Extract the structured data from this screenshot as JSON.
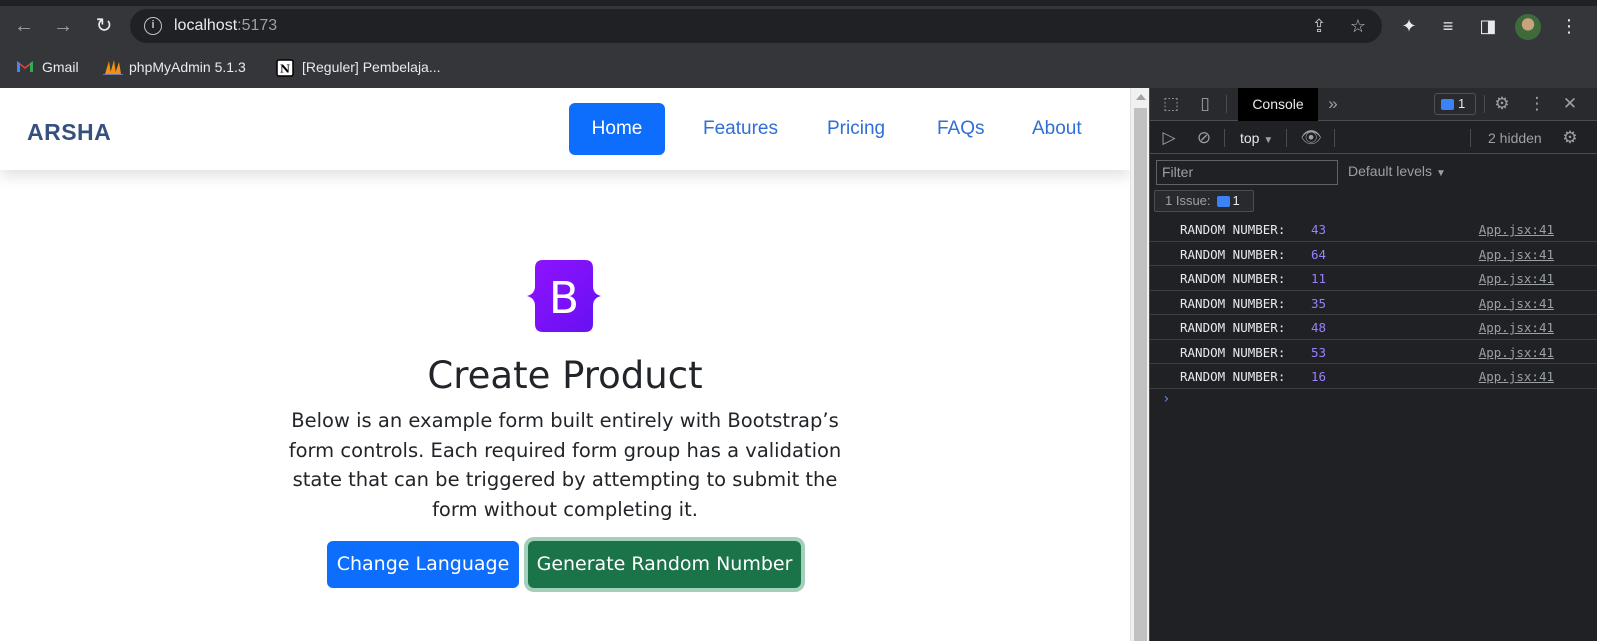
{
  "browser": {
    "url_host": "localhost",
    "url_port": ":5173",
    "bookmarks": [
      {
        "label": "Gmail"
      },
      {
        "label": "phpMyAdmin 5.1.3"
      },
      {
        "label": "[Reguler] Pembelaja..."
      }
    ]
  },
  "site": {
    "brand": "ARSHA",
    "nav": {
      "home": "Home",
      "features": "Features",
      "pricing": "Pricing",
      "faqs": "FAQs",
      "about": "About"
    },
    "logo_letter": "B",
    "title": "Create Product",
    "lead": "Below is an example form built entirely with Bootstrap’s form controls. Each required form group has a validation state that can be triggered by attempting to submit the form without completing it.",
    "buttons": {
      "change_language": "Change Language",
      "generate_random": "Generate Random Number"
    }
  },
  "devtools": {
    "tab_console": "Console",
    "issues_badge_count": "1",
    "context": "top",
    "hidden": "2 hidden",
    "filter_placeholder": "Filter",
    "levels": "Default levels",
    "issues_label": "1 Issue:",
    "issues_count": "1",
    "logs": [
      {
        "label": "RANDOM NUMBER:",
        "value": "43",
        "source": "App.jsx:41"
      },
      {
        "label": "RANDOM NUMBER:",
        "value": "64",
        "source": "App.jsx:41"
      },
      {
        "label": "RANDOM NUMBER:",
        "value": "11",
        "source": "App.jsx:41"
      },
      {
        "label": "RANDOM NUMBER:",
        "value": "35",
        "source": "App.jsx:41"
      },
      {
        "label": "RANDOM NUMBER:",
        "value": "48",
        "source": "App.jsx:41"
      },
      {
        "label": "RANDOM NUMBER:",
        "value": "53",
        "source": "App.jsx:41"
      },
      {
        "label": "RANDOM NUMBER:",
        "value": "16",
        "source": "App.jsx:41"
      }
    ]
  },
  "colors": {
    "primary": "#0d6efd",
    "success": "#1a7349",
    "brand": "#37517e",
    "log_value": "#9980ff"
  }
}
